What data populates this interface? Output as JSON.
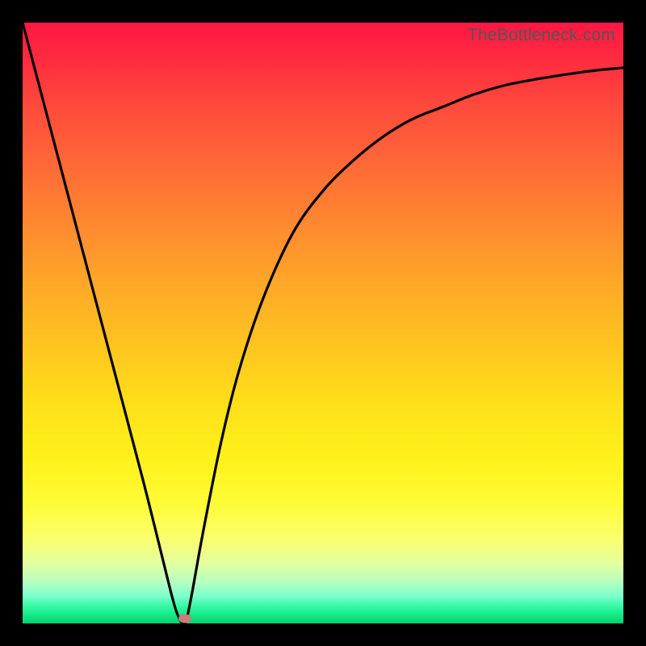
{
  "watermark": "TheBottleneck.com",
  "colors": {
    "frame": "#000000",
    "curve_stroke": "#000000",
    "marker_fill": "#cf7a7a",
    "gradient_top": "#ff1744",
    "gradient_bottom": "#00d36b"
  },
  "chart_data": {
    "type": "line",
    "title": "",
    "xlabel": "",
    "ylabel": "",
    "xlim": [
      0,
      100
    ],
    "ylim": [
      0,
      100
    ],
    "x": [
      0,
      5,
      10,
      15,
      20,
      23,
      25,
      26,
      27,
      28,
      30,
      33,
      36,
      40,
      45,
      50,
      55,
      60,
      65,
      70,
      75,
      80,
      85,
      90,
      95,
      100
    ],
    "values": [
      100,
      81,
      62,
      43,
      24,
      12,
      4,
      1,
      0,
      4,
      15,
      30,
      42,
      54,
      65,
      72,
      77,
      81,
      84,
      86,
      88,
      89.5,
      90.5,
      91.3,
      92,
      92.5
    ],
    "min_point": {
      "x": 27,
      "y": 0
    }
  }
}
